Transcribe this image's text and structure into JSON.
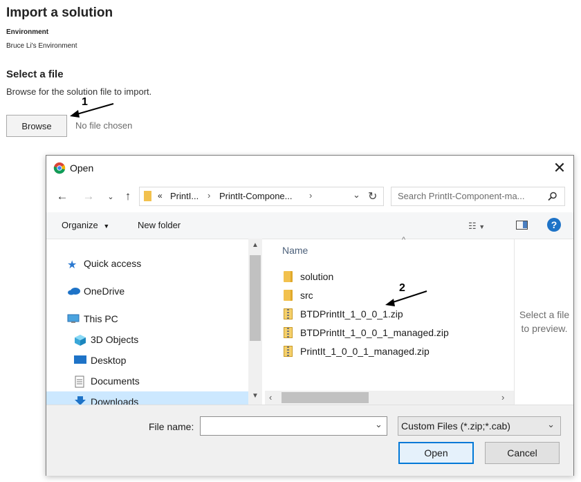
{
  "page": {
    "title": "Import a solution",
    "environment_label": "Environment",
    "environment_value": "Bruce Li's Environment",
    "section_title": "Select a file",
    "section_desc": "Browse for the solution file to import.",
    "browse_label": "Browse",
    "no_file": "No file chosen"
  },
  "annotations": {
    "step1": "1",
    "step2": "2"
  },
  "dialog": {
    "title": "Open",
    "close_icon": "close-icon",
    "breadcrumb": {
      "overflow": "«",
      "seg1": "PrintI...",
      "seg2": "PrintIt-Compone..."
    },
    "search_placeholder": "Search PrintIt-Component-ma...",
    "toolbar": {
      "organize": "Organize",
      "new_folder": "New folder"
    },
    "nav_items": [
      {
        "label": "Quick access",
        "icon": "star-icon"
      },
      {
        "label": "OneDrive",
        "icon": "cloud-icon"
      },
      {
        "label": "This PC",
        "icon": "computer-icon"
      },
      {
        "label": "3D Objects",
        "icon": "cube-icon"
      },
      {
        "label": "Desktop",
        "icon": "desktop-icon"
      },
      {
        "label": "Documents",
        "icon": "document-icon"
      },
      {
        "label": "Downloads",
        "icon": "download-icon"
      }
    ],
    "column_header": "Name",
    "files": [
      {
        "name": "solution",
        "type": "folder"
      },
      {
        "name": "src",
        "type": "folder"
      },
      {
        "name": "BTDPrintIt_1_0_0_1.zip",
        "type": "zip"
      },
      {
        "name": "BTDPrintIt_1_0_0_1_managed.zip",
        "type": "zip"
      },
      {
        "name": "PrintIt_1_0_0_1_managed.zip",
        "type": "zip"
      }
    ],
    "preview_text": "Select a file to preview.",
    "file_name_label": "File name:",
    "file_name_value": "",
    "file_type": "Custom Files (*.zip;*.cab)",
    "open_label": "Open",
    "cancel_label": "Cancel",
    "colors": {
      "accent": "#0078d7",
      "selected": "#cce8ff"
    }
  }
}
